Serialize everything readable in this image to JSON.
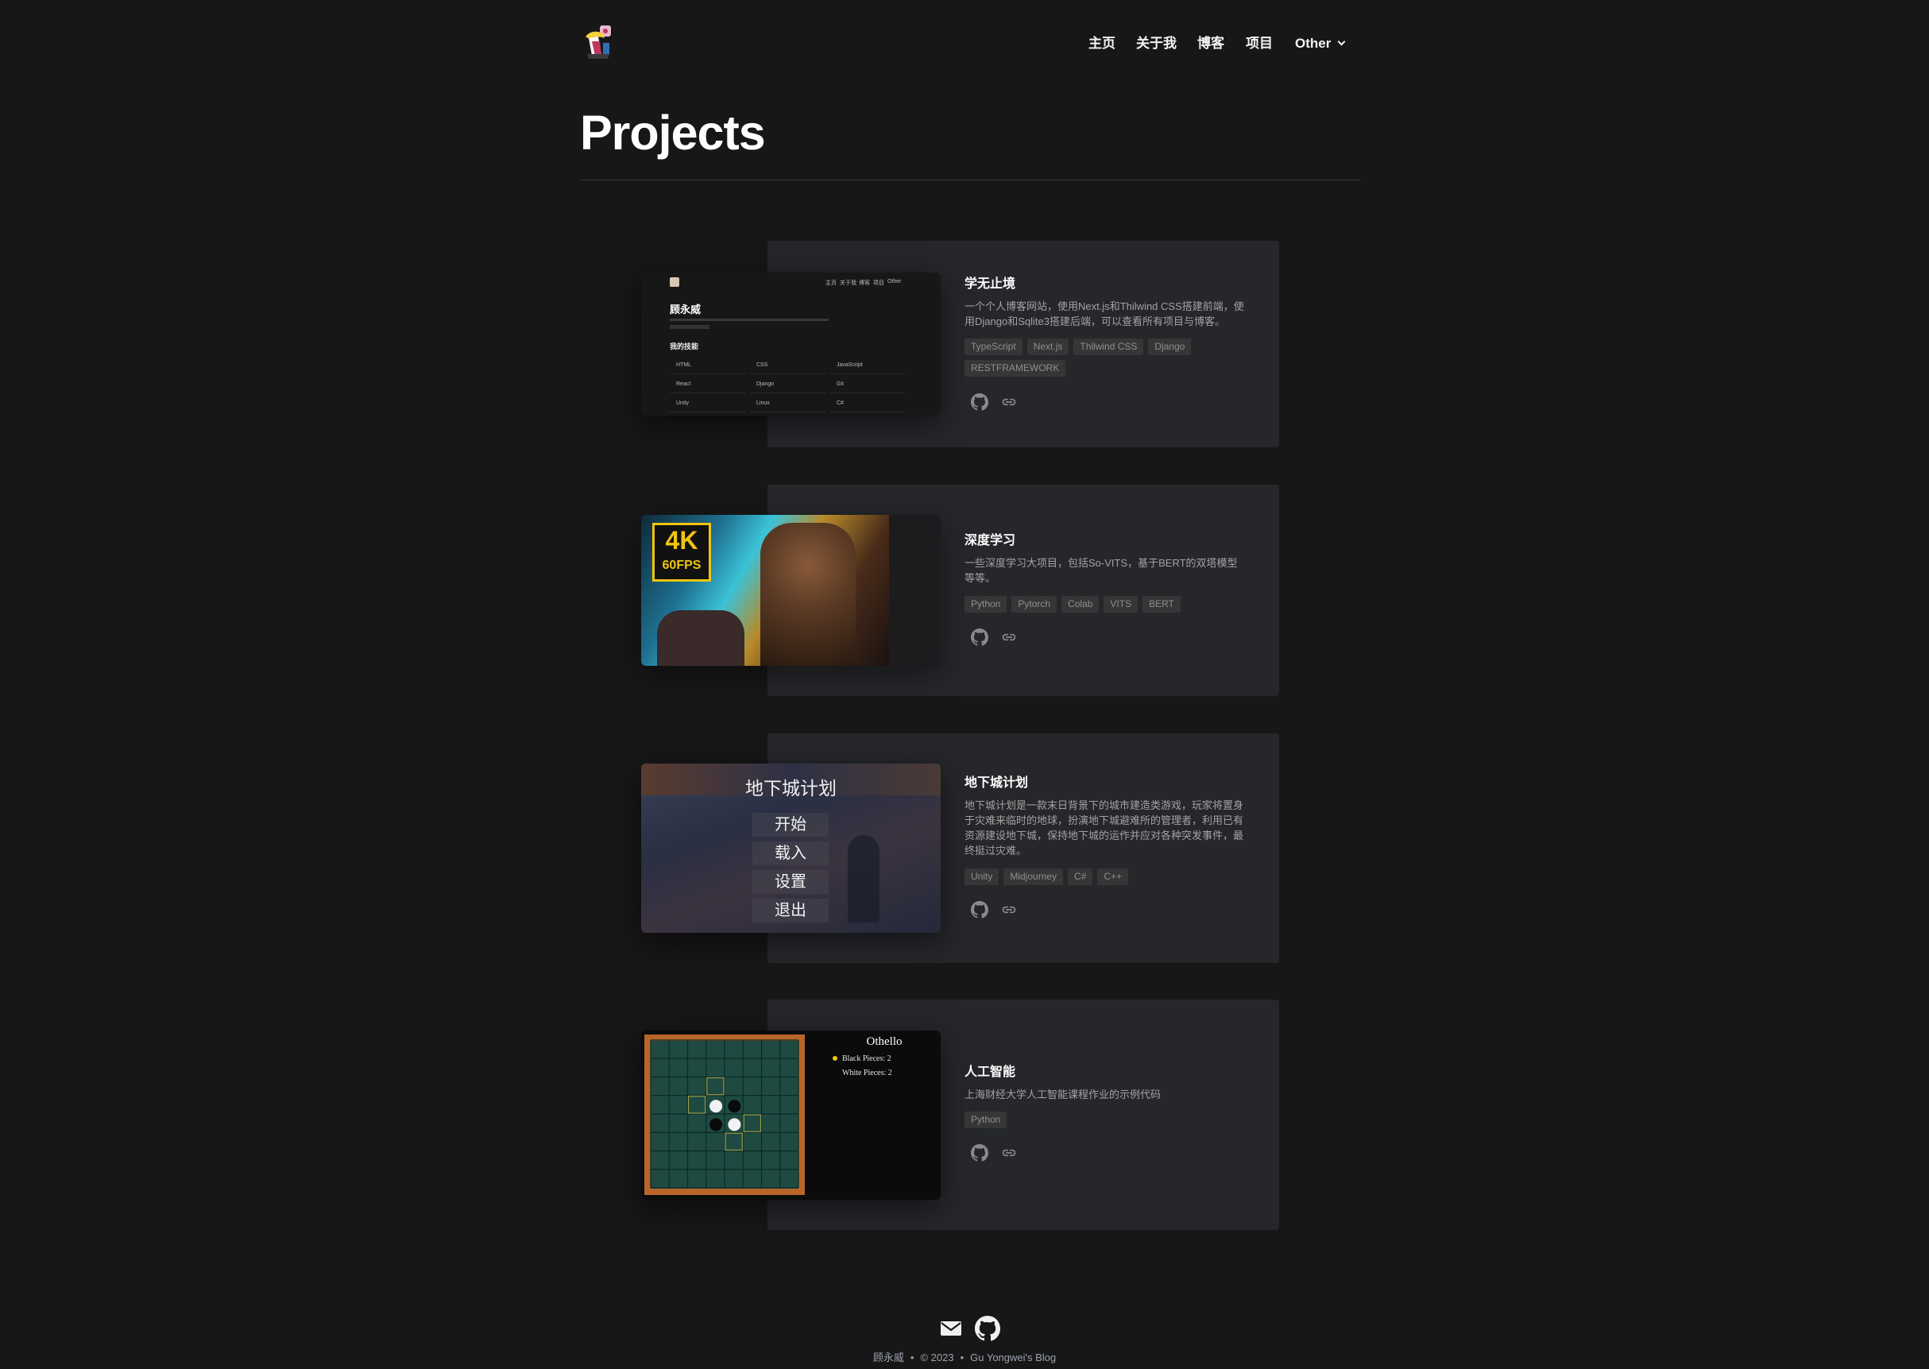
{
  "nav": {
    "items": [
      "主页",
      "关于我",
      "博客",
      "项目"
    ],
    "other_label": "Other"
  },
  "page_title": "Projects",
  "projects": [
    {
      "title": "学无止境",
      "description": "一个个人博客网站，使用Next.js和Thilwind CSS搭建前端，使用Django和Sqlite3搭建后端，可以查看所有项目与博客。",
      "tags": [
        "TypeScript",
        "Next.js",
        "Thilwind CSS",
        "Django",
        "RESTFRAMEWORK"
      ],
      "thumb": {
        "name": "顾永威",
        "skills_heading": "我的技能",
        "skills": [
          "HTML",
          "CSS",
          "JavaScript",
          "React",
          "Django",
          "Git",
          "Unity",
          "Linux",
          "C#"
        ],
        "nav": [
          "主页",
          "关于我",
          "博客",
          "项目",
          "Other"
        ]
      }
    },
    {
      "title": "深度学习",
      "description": "一些深度学习大项目，包括So-VITS，基于BERT的双塔模型等等。",
      "tags": [
        "Python",
        "Pytorch",
        "Colab",
        "VITS",
        "BERT"
      ],
      "thumb": {
        "badge_top": "4K",
        "badge_bottom": "60FPS"
      }
    },
    {
      "title": "地下城计划",
      "description": "地下城计划是一款末日背景下的城市建造类游戏，玩家将置身于灾难来临时的地球，扮演地下城避难所的管理者，利用已有资源建设地下城，保持地下城的运作并应对各种突发事件，最终挺过灾难。",
      "tags": [
        "Unity",
        "Midjourney",
        "C#",
        "C++"
      ],
      "thumb": {
        "game_title": "地下城计划",
        "menu": [
          "开始",
          "载入",
          "设置",
          "退出"
        ]
      }
    },
    {
      "title": "人工智能",
      "description": "上海财经大学人工智能课程作业的示例代码",
      "tags": [
        "Python"
      ],
      "thumb": {
        "game_title": "Othello",
        "black_pieces": "Black Pieces: 2",
        "white_pieces": "White Pieces: 2"
      }
    }
  ],
  "footer": {
    "name": "顾永威",
    "copyright": "© 2023",
    "site": "Gu Yongwei's Blog",
    "sep": "•"
  },
  "icons": {
    "project": [
      "github-icon",
      "link-icon"
    ],
    "footer": [
      "mail-icon",
      "github-icon"
    ]
  }
}
